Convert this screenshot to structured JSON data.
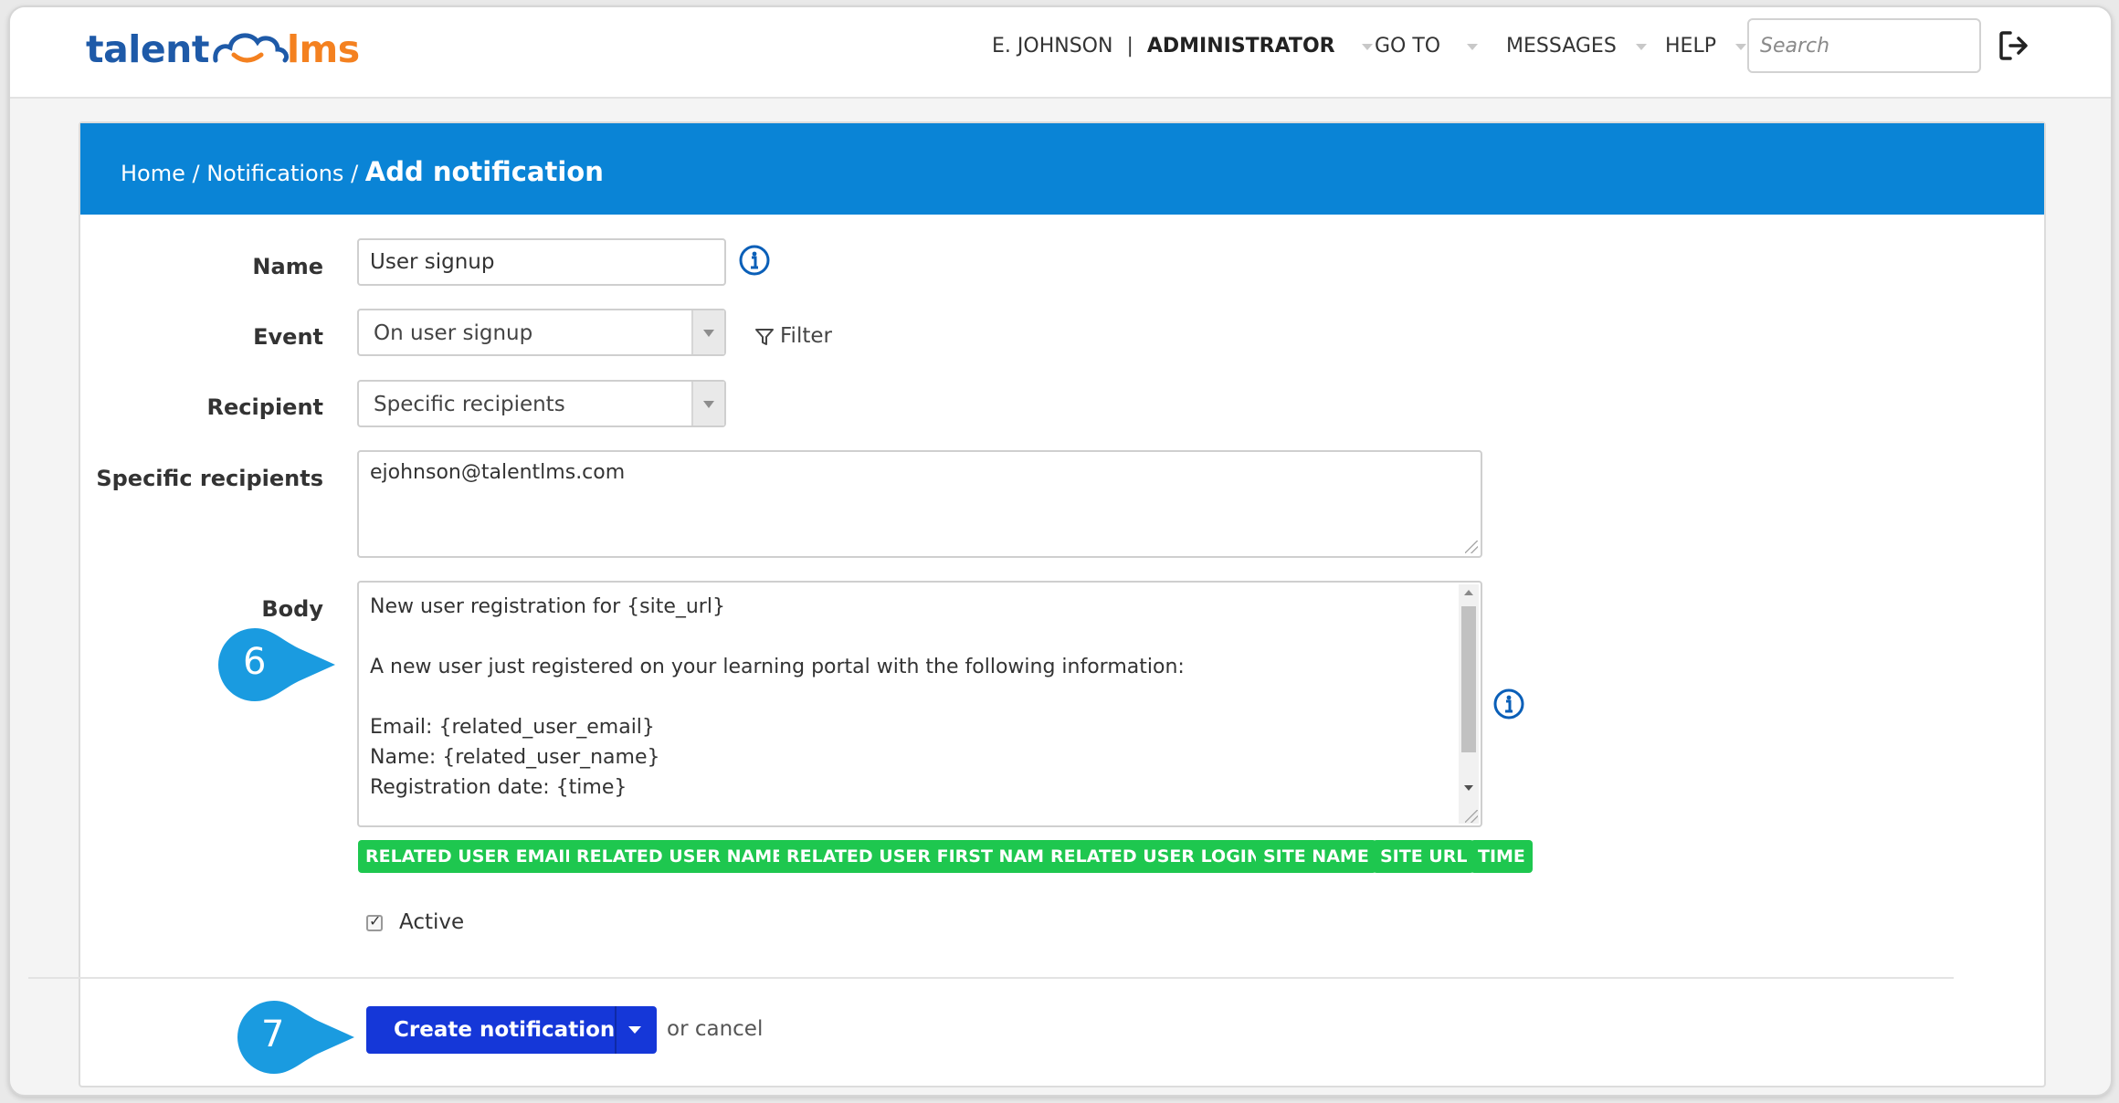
{
  "header": {
    "logo": {
      "word1": "talent",
      "word2": "lms"
    },
    "user": {
      "name": "E. JOHNSON",
      "separator": "|",
      "role": "ADMINISTRATOR"
    },
    "nav": [
      {
        "label": "GO TO"
      },
      {
        "label": "MESSAGES"
      },
      {
        "label": "HELP"
      }
    ],
    "search": {
      "placeholder": "Search",
      "value": ""
    },
    "logout_icon": "sign-out-icon"
  },
  "breadcrumb": {
    "home": "Home",
    "sep1": " / ",
    "notifications": "Notifications",
    "sep2": " / ",
    "current": "Add notification"
  },
  "form": {
    "name": {
      "label": "Name",
      "value": "User signup"
    },
    "event": {
      "label": "Event",
      "value": "On user signup",
      "filter_label": "Filter"
    },
    "recipient": {
      "label": "Recipient",
      "value": "Specific recipients"
    },
    "specific_recipients": {
      "label": "Specific recipients",
      "value": "ejohnson@talentlms.com"
    },
    "body": {
      "label": "Body",
      "value": "New user registration for {site_url}\n\nA new user just registered on your learning portal with the following information:\n\nEmail: {related_user_email}\nName: {related_user_name}\nRegistration date: {time}"
    },
    "tags": [
      "RELATED USER EMAIL",
      "RELATED USER NAME",
      "RELATED USER FIRST NAME",
      "RELATED USER LOGIN",
      "SITE NAME",
      "SITE URL",
      "TIME"
    ],
    "active": {
      "label": "Active",
      "checked": true
    },
    "submit_label": "Create notification",
    "or_text": "or cancel"
  },
  "markers": {
    "step6": "6",
    "step7": "7"
  },
  "colors": {
    "header_blue": "#0a84d6",
    "tag_green": "#1ec74f",
    "button_blue": "#1537d8",
    "marker_blue": "#1a9be0",
    "logo_blue": "#1e5aa8",
    "logo_orange": "#f48120"
  }
}
